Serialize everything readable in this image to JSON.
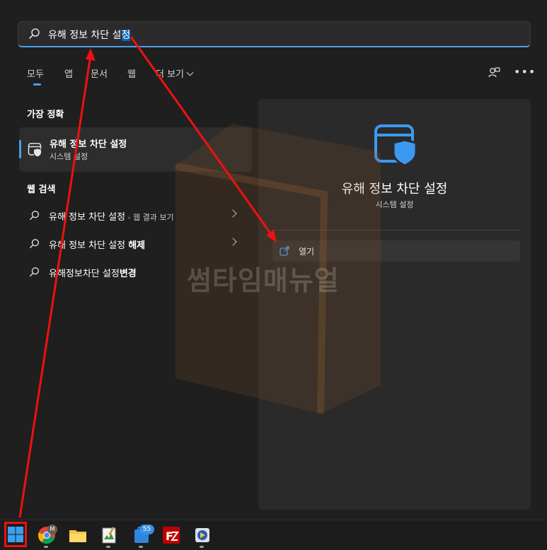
{
  "search": {
    "query_main": "유해 정보 차단 설",
    "query_selected": "정"
  },
  "tabs": [
    {
      "label": "모두"
    },
    {
      "label": "앱"
    },
    {
      "label": "문서"
    },
    {
      "label": "웹"
    },
    {
      "label": "더 보기"
    }
  ],
  "best_match": {
    "heading": "가장 정확",
    "title": "유해 정보 차단 설정",
    "subtitle": "시스템 설정"
  },
  "web_search": {
    "heading": "웹 검색",
    "items": [
      {
        "text": "유해 정보 차단 설정",
        "suffix": " - 웹 결과 보기"
      },
      {
        "text": "유해 정보 차단 설정 ",
        "bold": "해제"
      },
      {
        "text": "유해정보차단 설정",
        "bold": "변경"
      }
    ]
  },
  "preview": {
    "title": "유해 정보 차단 설정",
    "subtitle": "시스템 설정",
    "action_open": "열기"
  },
  "watermark": {
    "text": "썸타임매뉴얼"
  },
  "taskbar": {
    "chrome_badge": "M",
    "mail_badge": "55",
    "icons": [
      "windows-start-icon",
      "chrome-icon",
      "file-explorer-icon",
      "notepad-icon",
      "store-icon",
      "filezilla-icon",
      "media-icon"
    ]
  },
  "colors": {
    "accent": "#4a9fea",
    "annotation_red": "#ee1111",
    "panel_bg": "#1f1f1f"
  }
}
